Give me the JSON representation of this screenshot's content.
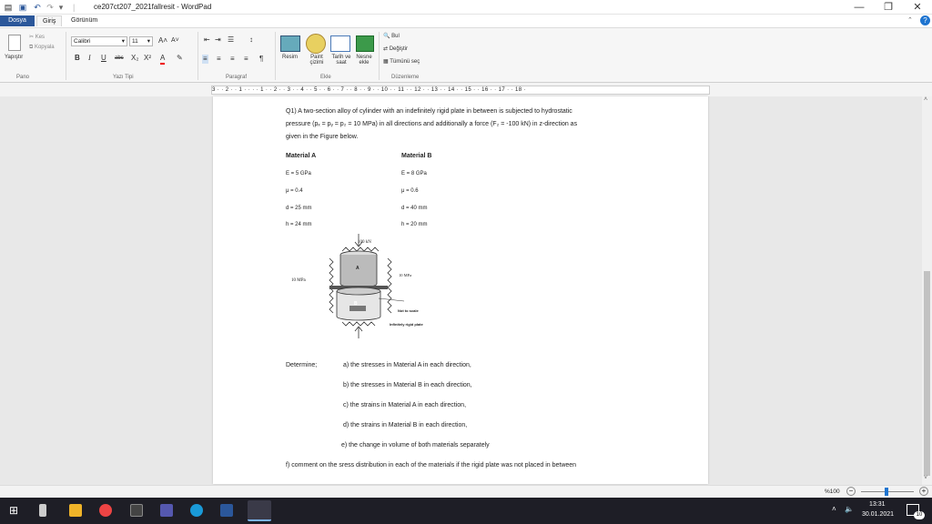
{
  "window": {
    "title": "ce207ct207_2021fallresit - WordPad",
    "minimize": "—",
    "maximize": "❐",
    "close": "✕"
  },
  "tabs": {
    "file": "Dosya",
    "home": "Giriş",
    "view": "Görünüm"
  },
  "ribbon": {
    "clipboard": {
      "paste": "Yapıştır",
      "cut": "Kes",
      "copy": "Kopyala",
      "group": "Pano"
    },
    "font": {
      "name": "Calibri",
      "size": "11",
      "group": "Yazı Tipi"
    },
    "paragraph": {
      "group": "Paragraf"
    },
    "insert": {
      "picture": "Resim",
      "paint": "Paint çizimi",
      "datetime": "Tarih ve saat",
      "object": "Nesne ekle",
      "group": "Ekle"
    },
    "editing": {
      "find": "Bul",
      "replace": "Değiştir",
      "select_all": "Tümünü seç",
      "group": "Düzenleme"
    }
  },
  "ruler": "3 · · 2 · · 1 · · · · 1 · · 2 · · 3 · · 4 · · 5 · · 6 · · 7 · · 8 · · 9 · · 10 · · 11 · · 12 · · 13 · · 14 · · 15 · · 16 · · 17 · · 18 ·",
  "doc": {
    "q1_line1": "Q1) A two-section alloy of cylinder with an indefinitely rigid plate in between is subjected to hydrostatic",
    "q1_line2": "pressure (pₓ = pᵧ = p₂ = 10 MPa) in all directions and additionally a force (F₂ = -100 kN) in z-direction as",
    "q1_line3": "given in the Figure below.",
    "matA": {
      "title": "Material A",
      "E": "E = 5 GPa",
      "mu": "μ = 0.4",
      "d": "d = 25 mm",
      "h": "h = 24 mm"
    },
    "matB": {
      "title": "Material B",
      "E": "E = 8 GPa",
      "mu": "μ = 0.6",
      "d": "d = 40 mm",
      "h": "h = 20 mm"
    },
    "figure": {
      "force": "100 kN",
      "pl": "10 MPa",
      "pr": "10 MPa",
      "a": "A",
      "b": "B",
      "scale": "Not to scale",
      "plate": "Infinitely rigid plate"
    },
    "determine": "Determine;",
    "items": [
      "a) the stresses in Material A in each direction,",
      "b) the stresses in Material B in each direction,",
      "c) the strains in Material A in each direction,",
      "d) the strains in Material B in each direction,",
      "e) the change in volume of both materials separately"
    ],
    "f": "f) comment on the sress distribution in each of the materials if the rigid plate was not placed in between"
  },
  "status": {
    "zoom": "%100"
  },
  "taskbar": {
    "time": "13:31",
    "date": "30.01.2021",
    "notif": "10"
  }
}
